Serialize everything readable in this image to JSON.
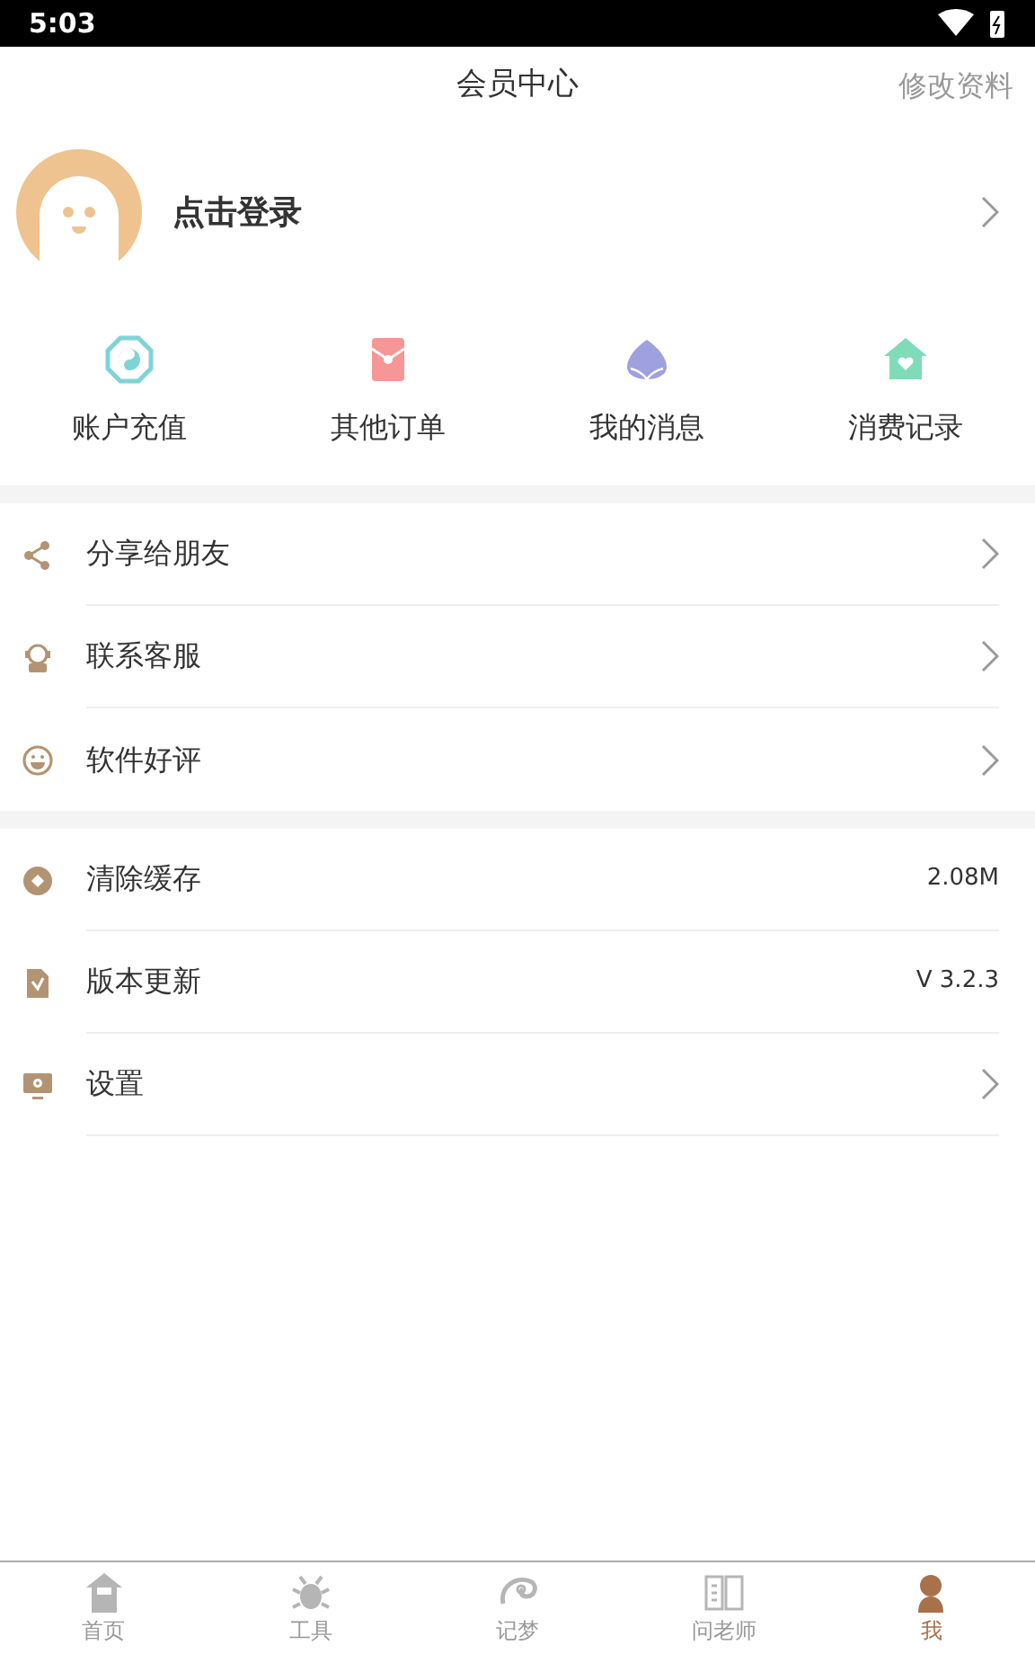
{
  "status_bar": {
    "time": "5:03"
  },
  "header": {
    "title": "会员中心",
    "action": "修改资料"
  },
  "profile": {
    "login_text": "点击登录"
  },
  "quick_actions": [
    {
      "label": "账户充值"
    },
    {
      "label": "其他订单"
    },
    {
      "label": "我的消息"
    },
    {
      "label": "消费记录"
    }
  ],
  "menu_groups": [
    [
      {
        "label": "分享给朋友",
        "kind": "arrow"
      },
      {
        "label": "联系客服",
        "kind": "arrow"
      },
      {
        "label": "软件好评",
        "kind": "arrow"
      }
    ],
    [
      {
        "label": "清除缓存",
        "kind": "value",
        "value": "2.08M"
      },
      {
        "label": "版本更新",
        "kind": "value",
        "value": "V 3.2.3"
      },
      {
        "label": "设置",
        "kind": "arrow"
      }
    ]
  ],
  "tab_bar": [
    {
      "label": "首页",
      "selected": false
    },
    {
      "label": "工具",
      "selected": false
    },
    {
      "label": "记梦",
      "selected": false
    },
    {
      "label": "问老师",
      "selected": false
    },
    {
      "label": "我",
      "selected": true
    }
  ]
}
